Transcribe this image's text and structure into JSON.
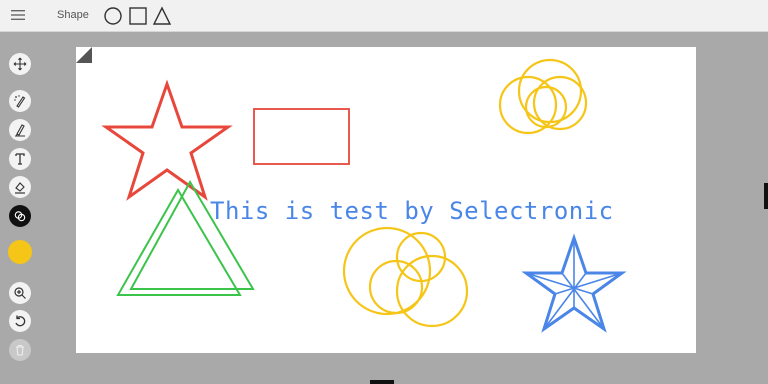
{
  "topbar": {
    "menu_icon": "hamburger-menu-icon",
    "shape_label": "Shape",
    "shape_options": [
      "circle",
      "square",
      "triangle"
    ]
  },
  "toolbar": {
    "tools": [
      "move-icon",
      "magic-pen-icon",
      "pen-icon",
      "text-icon",
      "fill-icon",
      "layers-icon",
      "color-swatch",
      "zoom-in-icon",
      "undo-icon",
      "delete-icon"
    ],
    "selected_color": "#f5c518"
  },
  "canvas": {
    "text": "This is test by Selectronic",
    "text_color": "#4a86e8",
    "colors": {
      "red": "#e8473b",
      "green": "#3bc44a",
      "yellow": "#f5c518",
      "blue": "#4a86e8"
    }
  }
}
